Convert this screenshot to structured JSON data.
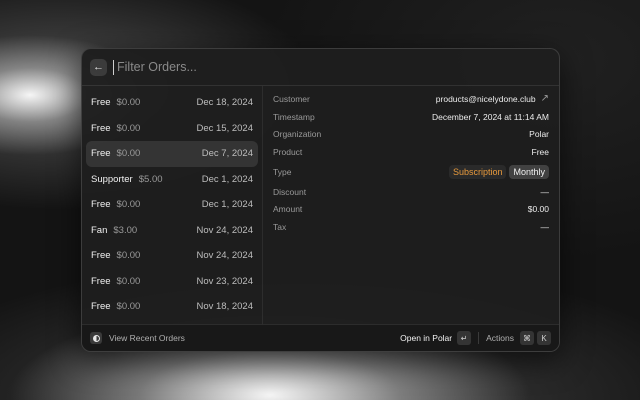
{
  "search": {
    "placeholder": "Filter Orders..."
  },
  "orders": [
    {
      "plan": "Free",
      "price": "$0.00",
      "date": "Dec 18, 2024"
    },
    {
      "plan": "Free",
      "price": "$0.00",
      "date": "Dec 15, 2024"
    },
    {
      "plan": "Free",
      "price": "$0.00",
      "date": "Dec 7, 2024"
    },
    {
      "plan": "Supporter",
      "price": "$5.00",
      "date": "Dec 1, 2024"
    },
    {
      "plan": "Free",
      "price": "$0.00",
      "date": "Dec 1, 2024"
    },
    {
      "plan": "Fan",
      "price": "$3.00",
      "date": "Nov 24, 2024"
    },
    {
      "plan": "Free",
      "price": "$0.00",
      "date": "Nov 24, 2024"
    },
    {
      "plan": "Free",
      "price": "$0.00",
      "date": "Nov 23, 2024"
    },
    {
      "plan": "Free",
      "price": "$0.00",
      "date": "Nov 18, 2024"
    }
  ],
  "selected_index": 2,
  "detail": {
    "customer_label": "Customer",
    "customer": "products@nicelydone.club",
    "timestamp_label": "Timestamp",
    "timestamp": "December 7, 2024 at 11:14 AM",
    "organization_label": "Organization",
    "organization": "Polar",
    "product_label": "Product",
    "product": "Free",
    "type_label": "Type",
    "type_tags": [
      "Subscription",
      "Monthly"
    ],
    "discount_label": "Discount",
    "discount": "—",
    "amount_label": "Amount",
    "amount": "$0.00",
    "tax_label": "Tax",
    "tax": "—"
  },
  "footer": {
    "recent_label": "View Recent Orders",
    "open_label": "Open in Polar",
    "enter_key": "↵",
    "actions_label": "Actions",
    "cmd_key": "⌘",
    "k_key": "K"
  },
  "colors": {
    "subscription_tag": "#e89a3c",
    "selected_row": "#3a3a3a"
  },
  "icons": {
    "back": "arrow-left-icon",
    "external": "arrow-up-right-icon",
    "logo": "polar-logo-icon"
  }
}
